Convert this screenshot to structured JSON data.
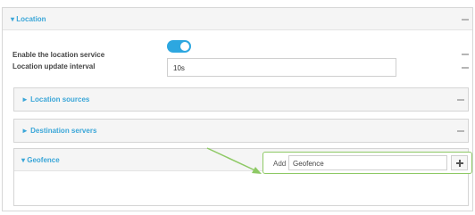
{
  "location_panel": {
    "title": "▾ Location",
    "enable_label": "Enable the location service",
    "enabled": true,
    "interval_label": "Location update interval",
    "interval_value": "10s"
  },
  "subpanels": {
    "sources": "► Location sources",
    "destinations": "► Destination servers",
    "geofence": "▾ Geofence"
  },
  "geofence_add": {
    "add_label": "Add",
    "input_value": "Geofence"
  },
  "colors": {
    "accent": "#3aa6d8",
    "toggle_on": "#2da7e0",
    "highlight": "#8ec965"
  }
}
